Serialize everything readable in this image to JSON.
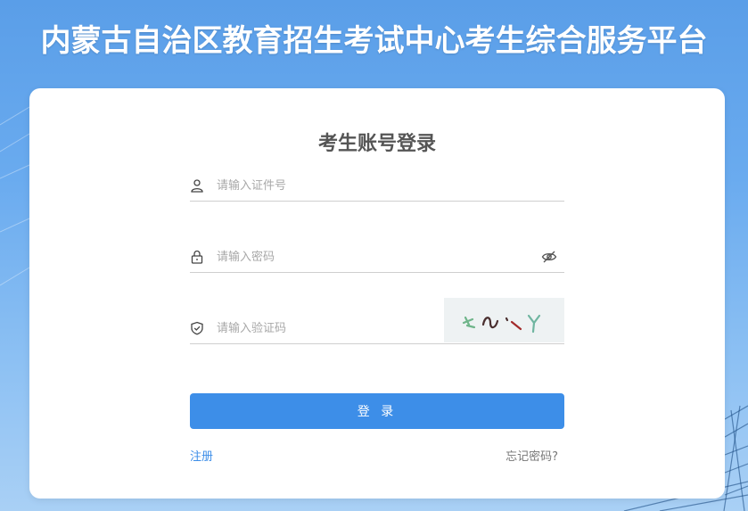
{
  "header": {
    "title": "内蒙古自治区教育招生考试中心考生综合服务平台"
  },
  "login": {
    "title": "考生账号登录",
    "id_field": {
      "placeholder": "请输入证件号",
      "value": "",
      "icon": "user-icon"
    },
    "password_field": {
      "placeholder": "请输入密码",
      "value": "",
      "icon": "lock-icon",
      "toggle_icon": "eye-hidden-icon"
    },
    "captcha_field": {
      "placeholder": "请输入验证码",
      "value": "",
      "icon": "shield-check-icon"
    },
    "captcha_image_chars": "x ~ - y",
    "submit_label": "登 录",
    "register_label": "注册",
    "forgot_label": "忘记密码?"
  },
  "colors": {
    "accent": "#3d8ee8",
    "background": "#6aabef",
    "card": "#ffffff"
  }
}
